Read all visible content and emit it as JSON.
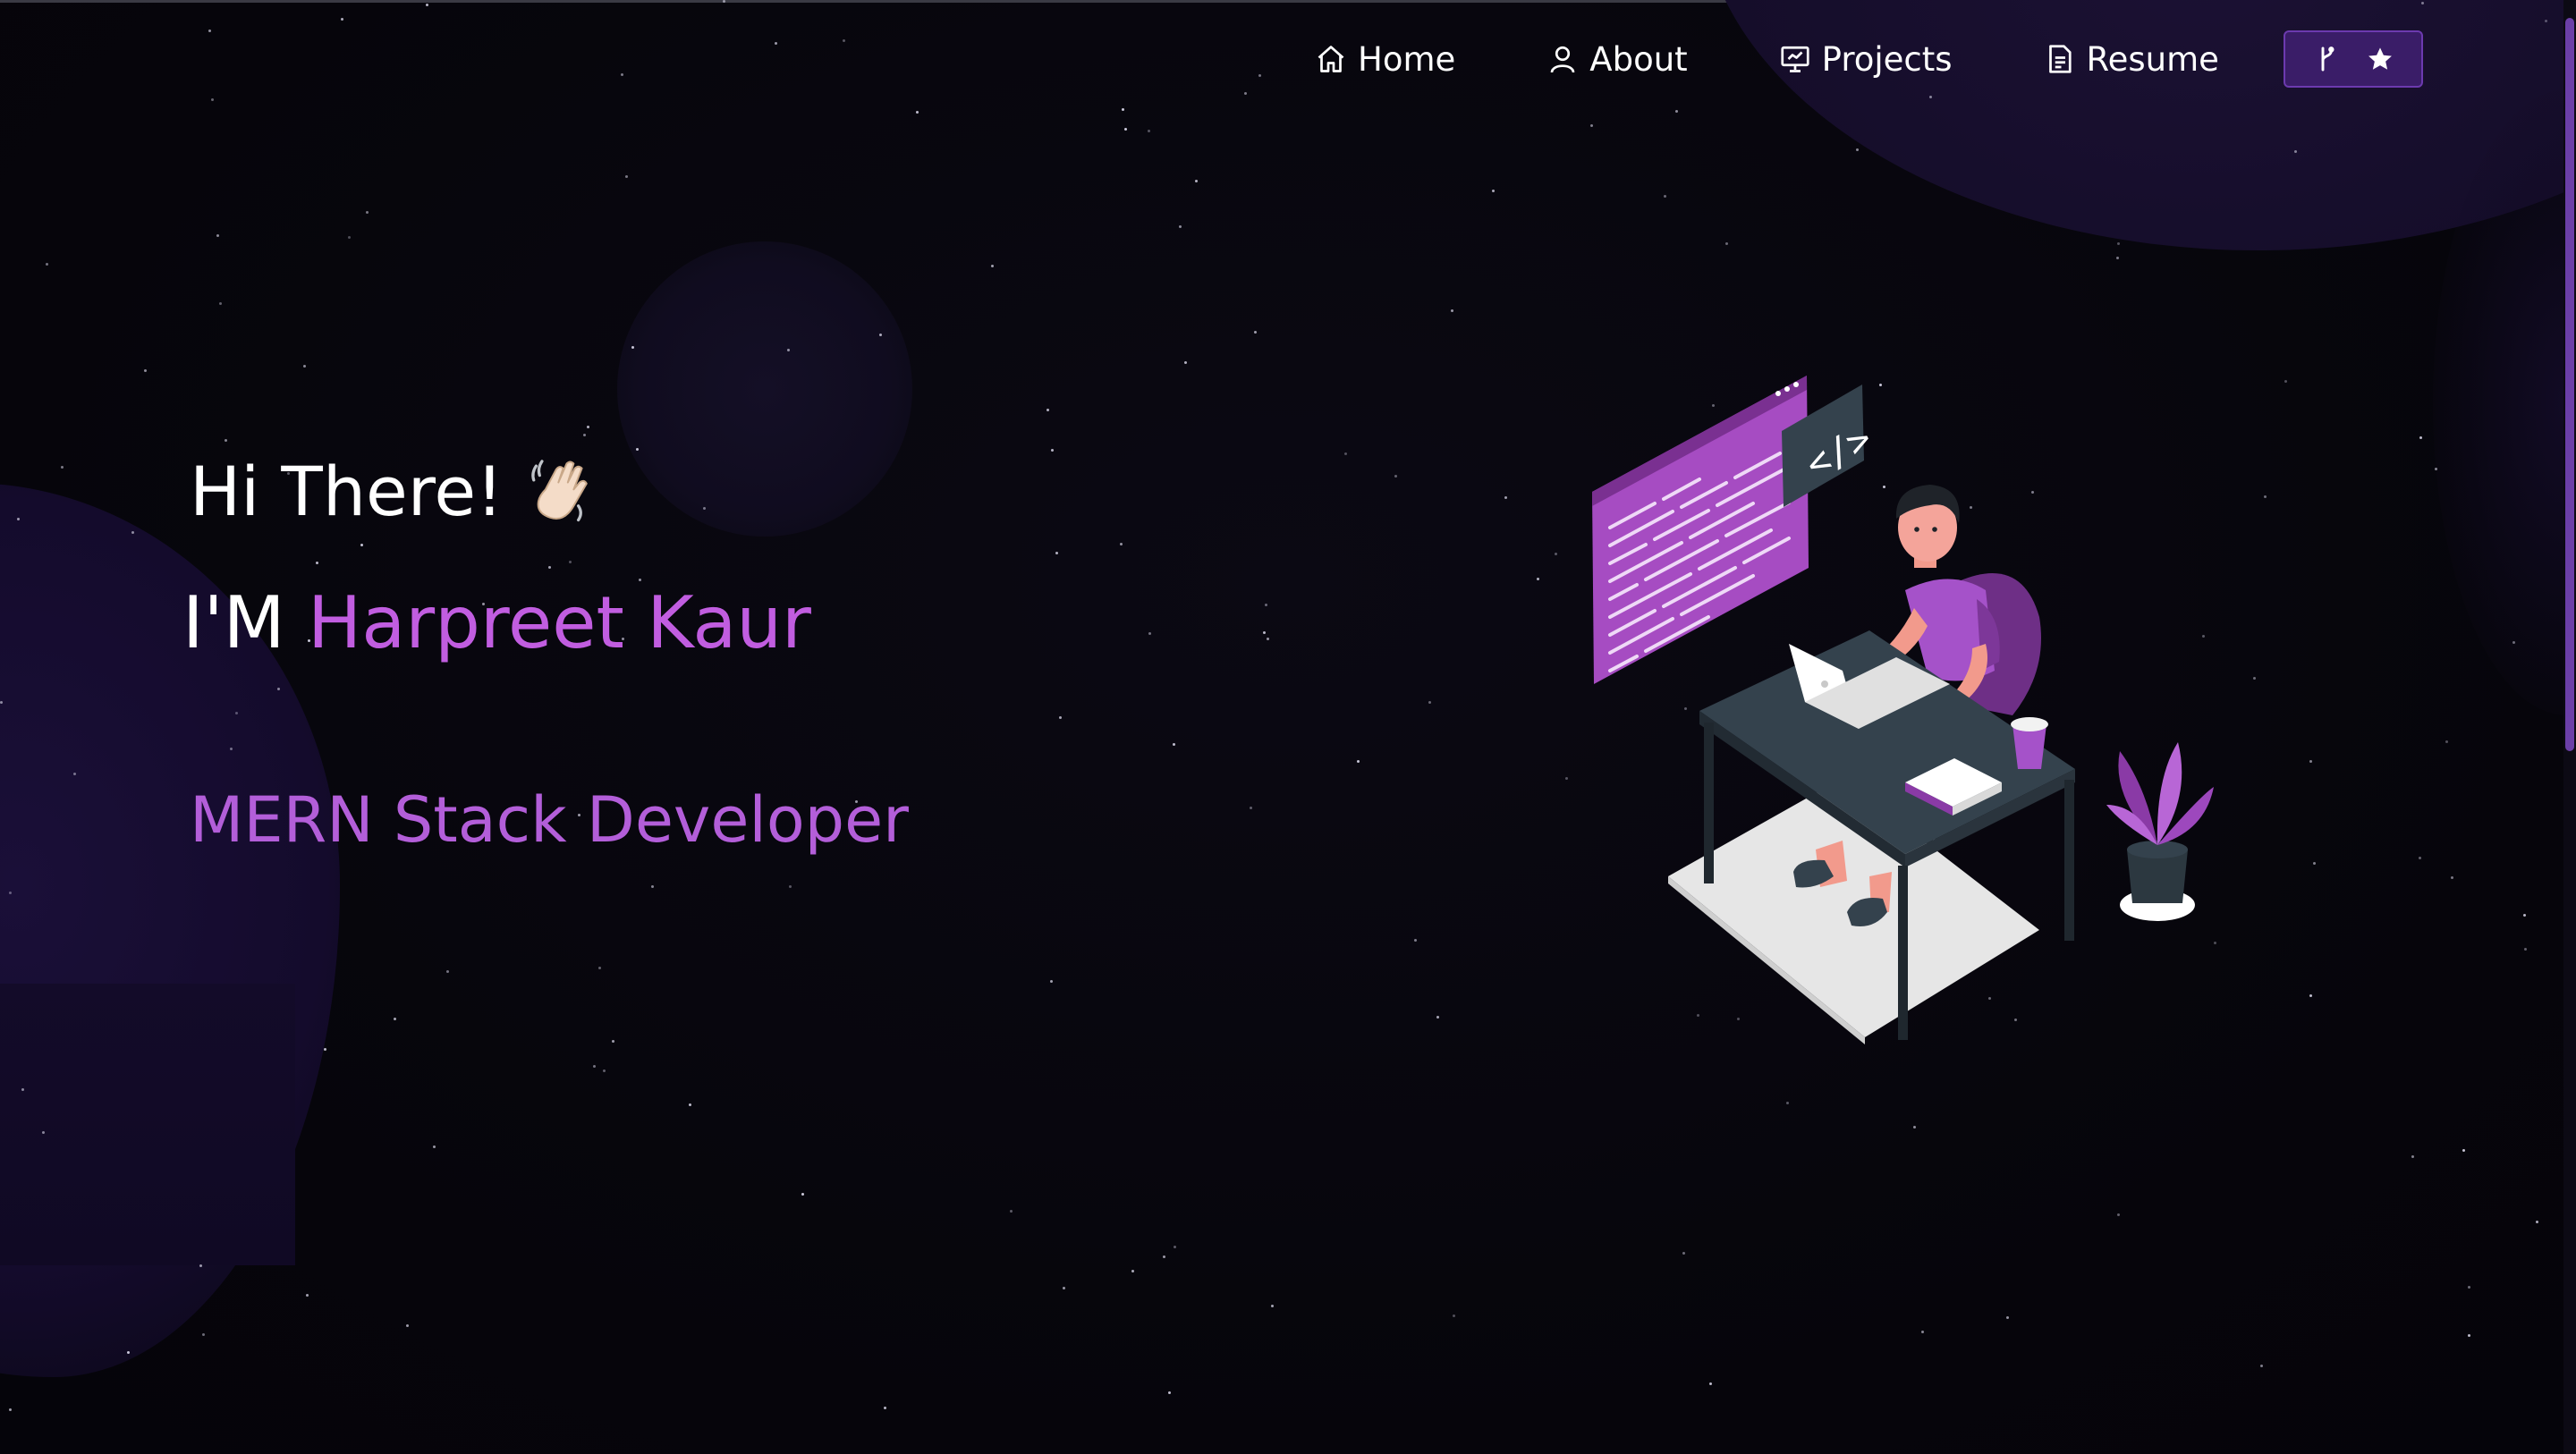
{
  "nav": {
    "items": [
      {
        "label": "Home",
        "icon": "home-icon"
      },
      {
        "label": "About",
        "icon": "user-icon"
      },
      {
        "label": "Projects",
        "icon": "projects-icon"
      },
      {
        "label": "Resume",
        "icon": "document-icon"
      }
    ],
    "github_button": {
      "icons": [
        "fork-icon",
        "star-icon"
      ]
    }
  },
  "hero": {
    "greeting": "Hi There!",
    "greeting_emoji": "waving-hand-icon",
    "intro_prefix": "I'M ",
    "name": "Harpreet Kaur",
    "role": "MERN Stack Developer",
    "illustration": "developer-at-desk-illustration"
  },
  "colors": {
    "background": "#07060d",
    "accent": "#c15de0",
    "role_text": "#b35ed9",
    "button_bg": "#3a1d68",
    "button_border": "#6c3aaf",
    "text": "#ffffff"
  }
}
